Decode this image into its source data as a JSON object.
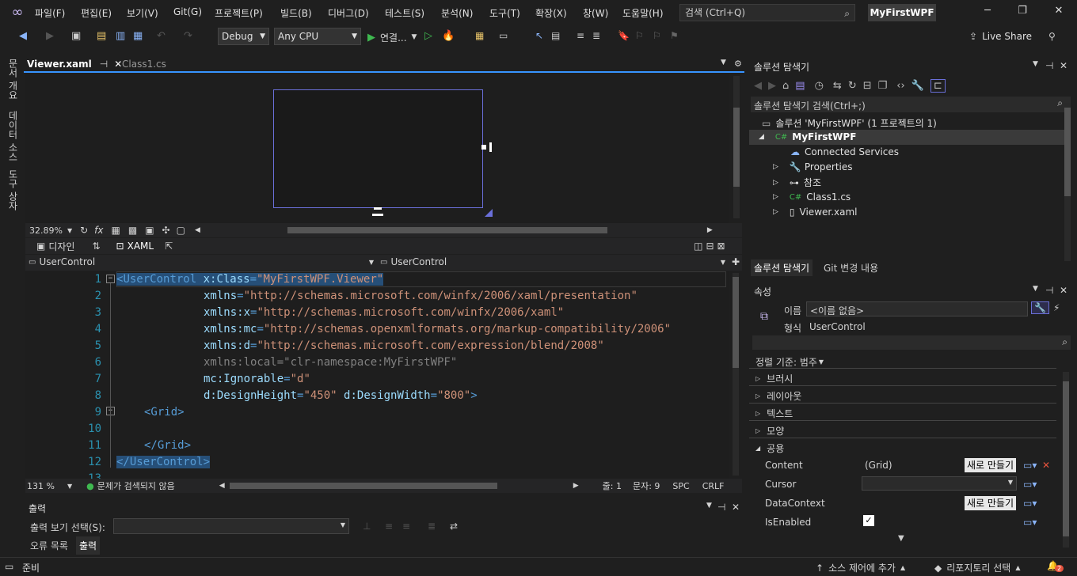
{
  "menu": [
    "파일(F)",
    "편집(E)",
    "보기(V)",
    "Git(G)",
    "프로젝트(P)",
    "빌드(B)",
    "디버그(D)",
    "테스트(S)",
    "분석(N)",
    "도구(T)",
    "확장(X)",
    "창(W)",
    "도움말(H)"
  ],
  "search": {
    "placeholder": "검색 (Ctrl+Q)"
  },
  "project_name": "MyFirstWPF",
  "toolbar": {
    "config": "Debug",
    "platform": "Any CPU",
    "run": "연결...",
    "live_share": "Live Share"
  },
  "side": [
    "문서 개요",
    "데이터 소스",
    "도구 상자"
  ],
  "tabs": [
    {
      "label": "Viewer.xaml",
      "pin": "⊣"
    },
    {
      "label": "Class1.cs"
    }
  ],
  "designer": {
    "zoom": "32.89%",
    "design_tab": "디자인",
    "xaml_tab": "XAML"
  },
  "nav": {
    "left": "UserControl",
    "right": "UserControl"
  },
  "code": {
    "lines": [
      {
        "n": "1",
        "parts": [
          [
            "t",
            "<"
          ],
          [
            "t",
            "UserControl"
          ],
          [
            "a",
            " x:Class"
          ],
          [
            "t",
            "="
          ],
          [
            "v",
            "\"MyFirstWPF.Viewer\""
          ]
        ]
      },
      {
        "n": "2",
        "parts": [
          [
            "a",
            "xmlns"
          ],
          [
            "t",
            "="
          ],
          [
            "v",
            "\"http://schemas.microsoft.com/winfx/2006/xaml/presentation\""
          ]
        ]
      },
      {
        "n": "3",
        "parts": [
          [
            "a",
            "xmlns:x"
          ],
          [
            "t",
            "="
          ],
          [
            "v",
            "\"http://schemas.microsoft.com/winfx/2006/xaml\""
          ]
        ]
      },
      {
        "n": "4",
        "parts": [
          [
            "a",
            "xmlns:mc"
          ],
          [
            "t",
            "="
          ],
          [
            "v",
            "\"http://schemas.openxmlformats.org/markup-compatibility/2006\""
          ]
        ]
      },
      {
        "n": "5",
        "parts": [
          [
            "a",
            "xmlns:d"
          ],
          [
            "t",
            "="
          ],
          [
            "v",
            "\"http://schemas.microsoft.com/expression/blend/2008\""
          ]
        ]
      },
      {
        "n": "6",
        "parts": [
          [
            "g",
            "xmlns:local=\"clr-namespace:MyFirstWPF\""
          ]
        ]
      },
      {
        "n": "7",
        "parts": [
          [
            "a",
            "mc:Ignorable"
          ],
          [
            "t",
            "="
          ],
          [
            "v",
            "\"d\""
          ]
        ]
      },
      {
        "n": "8",
        "parts": [
          [
            "a",
            "d:DesignHeight"
          ],
          [
            "t",
            "="
          ],
          [
            "v",
            "\"450\""
          ],
          [
            "a",
            " d:DesignWidth"
          ],
          [
            "t",
            "="
          ],
          [
            "v",
            "\"800\""
          ],
          [
            "t",
            ">"
          ]
        ]
      },
      {
        "n": "9",
        "parts": [
          [
            "t",
            "<Grid>"
          ]
        ]
      },
      {
        "n": "10",
        "parts": []
      },
      {
        "n": "11",
        "parts": [
          [
            "t",
            "</Grid>"
          ]
        ]
      },
      {
        "n": "12",
        "parts": [
          [
            "t",
            "</UserControl>"
          ]
        ]
      },
      {
        "n": "13",
        "parts": []
      }
    ]
  },
  "editor_status": {
    "zoom": "131 %",
    "issues": "문제가 검색되지 않음",
    "line": "줄: 1",
    "char": "문자: 9",
    "spc": "SPC",
    "crlf": "CRLF"
  },
  "output": {
    "title": "출력",
    "select_label": "출력 보기 선택(S):",
    "tab_errors": "오류 목록",
    "tab_output": "출력"
  },
  "solution": {
    "title": "솔루션 탐색기",
    "search": "솔루션 탐색기 검색(Ctrl+;)",
    "root": "솔루션 'MyFirstWPF' (1 프로젝트의 1)",
    "project": "MyFirstWPF",
    "items": [
      "Connected Services",
      "Properties",
      "참조",
      "Class1.cs",
      "Viewer.xaml"
    ],
    "bottom_tabs": [
      "솔루션 탐색기",
      "Git 변경 내용"
    ]
  },
  "properties": {
    "title": "속성",
    "name_label": "이름",
    "name_value": "<이름 없음>",
    "type_label": "형식",
    "type_value": "UserControl",
    "sort": "정렬 기준: 범주",
    "categories": [
      "브러시",
      "레이아웃",
      "텍스트",
      "모양",
      "공용"
    ],
    "rows": [
      {
        "name": "Content",
        "value": "(Grid)",
        "btn": "새로 만들기"
      },
      {
        "name": "Cursor",
        "value": "",
        "btn": ""
      },
      {
        "name": "DataContext",
        "value": "",
        "btn": "새로 만들기"
      },
      {
        "name": "IsEnabled",
        "value": "✓",
        "btn": ""
      }
    ]
  },
  "statusbar": {
    "ready": "준비",
    "source_control": "소스 제어에 추가",
    "repo": "리포지토리 선택",
    "notifications": "2"
  }
}
